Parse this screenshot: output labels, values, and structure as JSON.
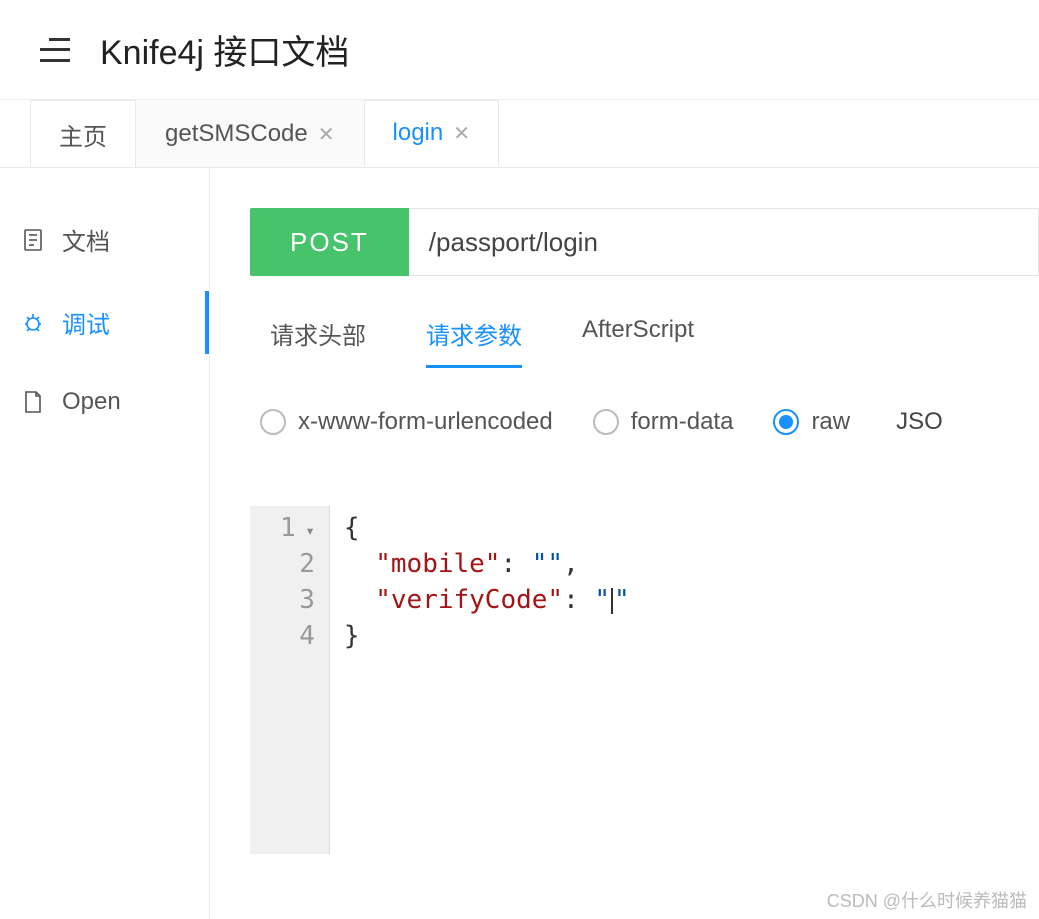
{
  "header": {
    "title": "Knife4j 接口文档"
  },
  "tabs": {
    "home": "主页",
    "items": [
      {
        "label": "getSMSCode",
        "active": false
      },
      {
        "label": "login",
        "active": true
      }
    ]
  },
  "sidebar": {
    "doc": "文档",
    "debug": "调试",
    "open": "Open"
  },
  "request": {
    "method": "POST",
    "path": "/passport/login"
  },
  "subTabs": {
    "headers": "请求头部",
    "params": "请求参数",
    "after": "AfterScript"
  },
  "bodyTypes": {
    "form": "x-www-form-urlencoded",
    "formdata": "form-data",
    "raw": "raw",
    "format": "JSO"
  },
  "editor": {
    "lines": [
      "1",
      "2",
      "3",
      "4"
    ],
    "code": {
      "l1": "{",
      "l2_key": "\"mobile\"",
      "l2_sep": ": ",
      "l2_val": "\"\"",
      "l2_comma": ",",
      "l3_key": "\"verifyCode\"",
      "l3_sep": ": ",
      "l3_val_open": "\"",
      "l3_val_close": "\"",
      "l4": "}"
    }
  },
  "watermark": "CSDN @什么时候养猫猫"
}
